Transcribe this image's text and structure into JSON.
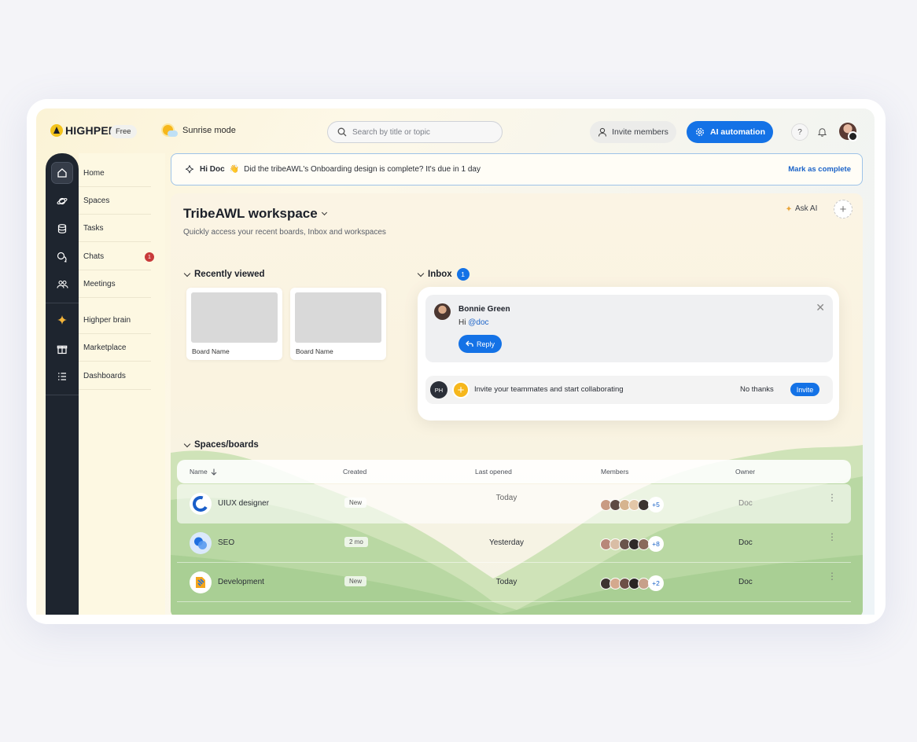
{
  "app": {
    "name": "HIGHPER",
    "plan": "Free",
    "mode": "Sunrise mode"
  },
  "search": {
    "placeholder": "Search by title or topic"
  },
  "header": {
    "invite_label": "Invite members",
    "ai_label": "AI automation",
    "help_label": "?"
  },
  "sidebar": {
    "items": [
      {
        "label": "Home",
        "icon": "home-icon"
      },
      {
        "label": "Spaces",
        "icon": "planet-icon"
      },
      {
        "label": "Tasks",
        "icon": "database-icon"
      },
      {
        "label": "Chats",
        "icon": "chat-icon",
        "badge": "1"
      },
      {
        "label": "Meetings",
        "icon": "people-icon"
      },
      {
        "label": "Highper brain",
        "icon": "sparkle-icon"
      },
      {
        "label": "Marketplace",
        "icon": "gift-icon"
      },
      {
        "label": "Dashboards",
        "icon": "list-icon"
      }
    ]
  },
  "notice": {
    "greeting": "Hi Doc",
    "emoji": "👋",
    "message": "Did the tribeAWL's Onboarding design is complete? It's due in 1 day",
    "action": "Mark as complete"
  },
  "workspace": {
    "title": "TribeAWL workspace",
    "subtitle": "Quickly access your recent boards, Inbox and workspaces",
    "ask_ai": "Ask AI",
    "add": "+"
  },
  "recent": {
    "heading": "Recently viewed",
    "boards": [
      {
        "name": "Board Name"
      },
      {
        "name": "Board Name"
      }
    ]
  },
  "inbox": {
    "heading": "Inbox",
    "count": "1",
    "message": {
      "sender": "Bonnie Green",
      "greeting": "Hi",
      "mention": "@doc",
      "reply_label": "Reply",
      "close": "✕"
    },
    "invite": {
      "initials": "PH",
      "plus": "+",
      "text": "Invite your teammates and start collaborating",
      "decline": "No thanks",
      "accept": "Invite"
    }
  },
  "spaces": {
    "heading": "Spaces/boards",
    "columns": {
      "name": "Name",
      "created": "Created",
      "last_opened": "Last opened",
      "members": "Members",
      "owner": "Owner"
    },
    "rows": [
      {
        "name": "UIUX designer",
        "created": "New",
        "last_opened": "Today",
        "members_more": "+5",
        "owner": "Doc",
        "icon_color": "#1a5ec9"
      },
      {
        "name": "SEO",
        "created": "2 mo",
        "last_opened": "Yesterday",
        "members_more": "+8",
        "owner": "Doc",
        "icon_color": "#2f7be8"
      },
      {
        "name": "Development",
        "created": "New",
        "last_opened": "Today",
        "members_more": "+2",
        "owner": "Doc",
        "icon_color": "#f4a51c"
      }
    ]
  },
  "colors": {
    "accent": "#1472e6",
    "rail": "#1e252f",
    "sidebar_bg": "#fdf8e2",
    "badge_red": "#c83a3a",
    "sun": "#f6b71c"
  }
}
